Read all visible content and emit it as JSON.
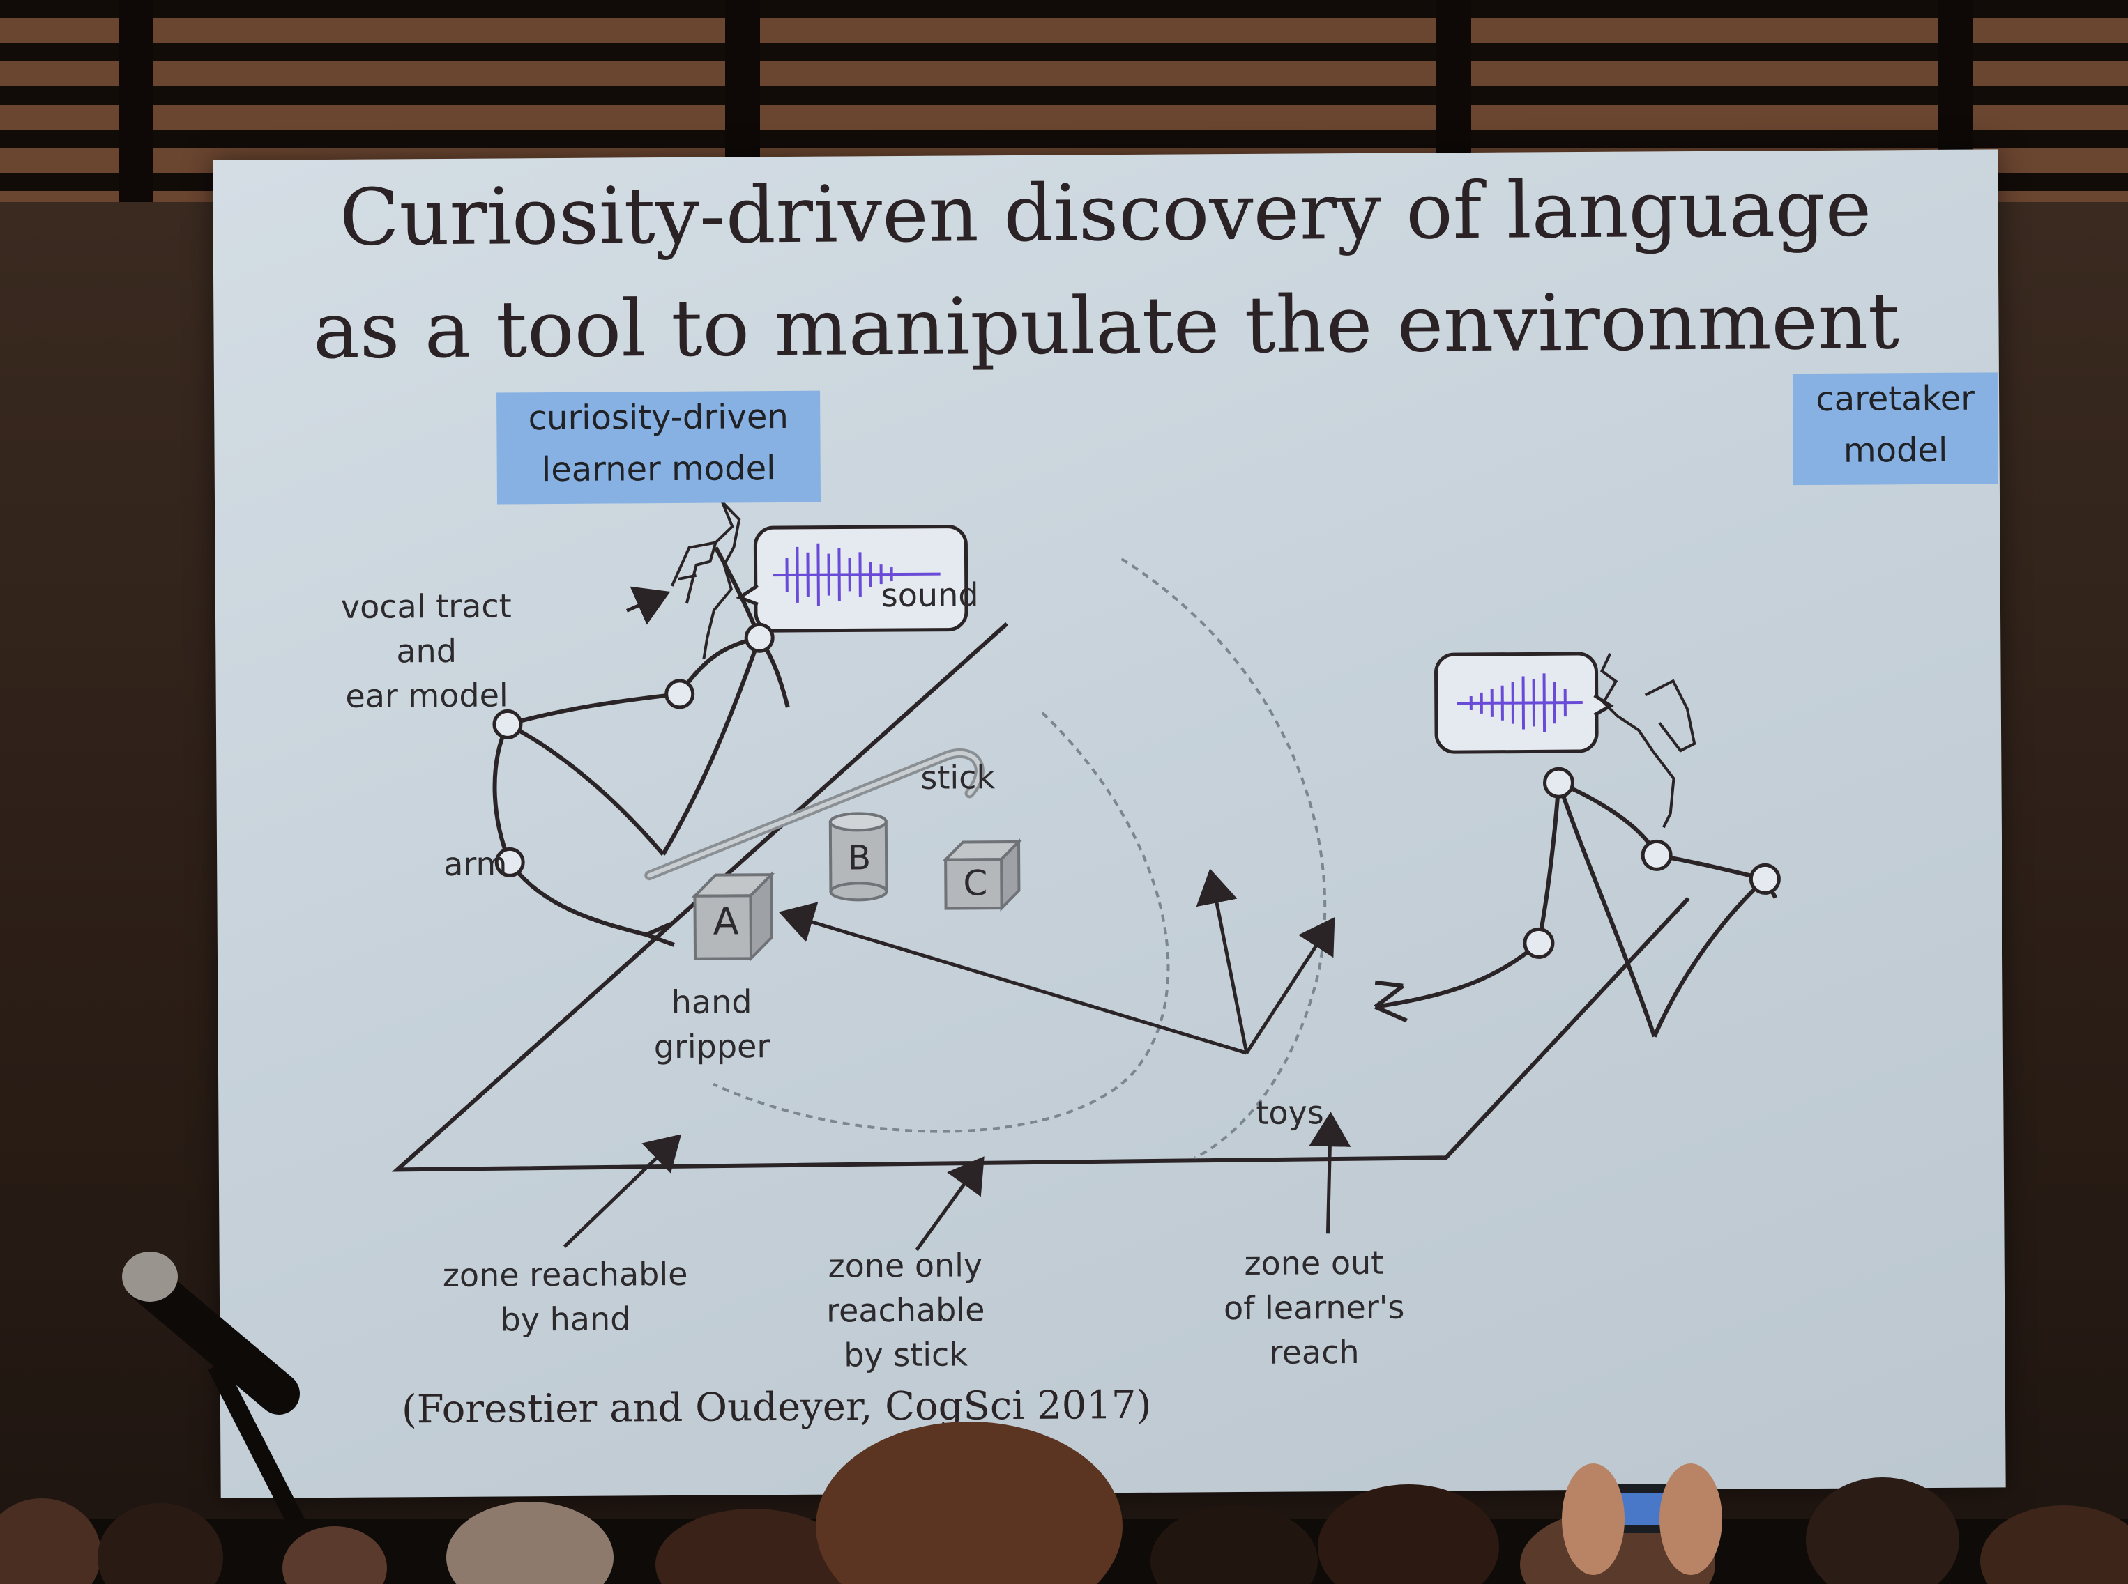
{
  "slide": {
    "title_line1": "Curiosity-driven discovery of language",
    "title_line2": "as a tool to manipulate the environment",
    "learner_tag": [
      "curiosity-driven",
      "learner model"
    ],
    "caretaker_tag": [
      "caretaker",
      "model"
    ],
    "sound_label": "sound",
    "labels": {
      "vocal_tract": [
        "vocal tract",
        "and",
        "ear model"
      ],
      "arm": "arm",
      "hand_gripper": [
        "hand",
        "gripper"
      ],
      "stick": "stick",
      "toys": "toys",
      "toy_a": "A",
      "toy_b": "B",
      "toy_c": "C",
      "zone_hand": [
        "zone reachable",
        "by hand"
      ],
      "zone_stick": [
        "zone only",
        "reachable",
        "by stick"
      ],
      "zone_out": [
        "zone out",
        "of learner's",
        "reach"
      ]
    },
    "citation": "(Forestier and Oudeyer, CogSci 2017)"
  },
  "colors": {
    "slide_background": "#c9d3db",
    "tag_blue": "#86b1e2",
    "waveform_purple": "#6a4bd8",
    "ink": "#2a2426"
  }
}
